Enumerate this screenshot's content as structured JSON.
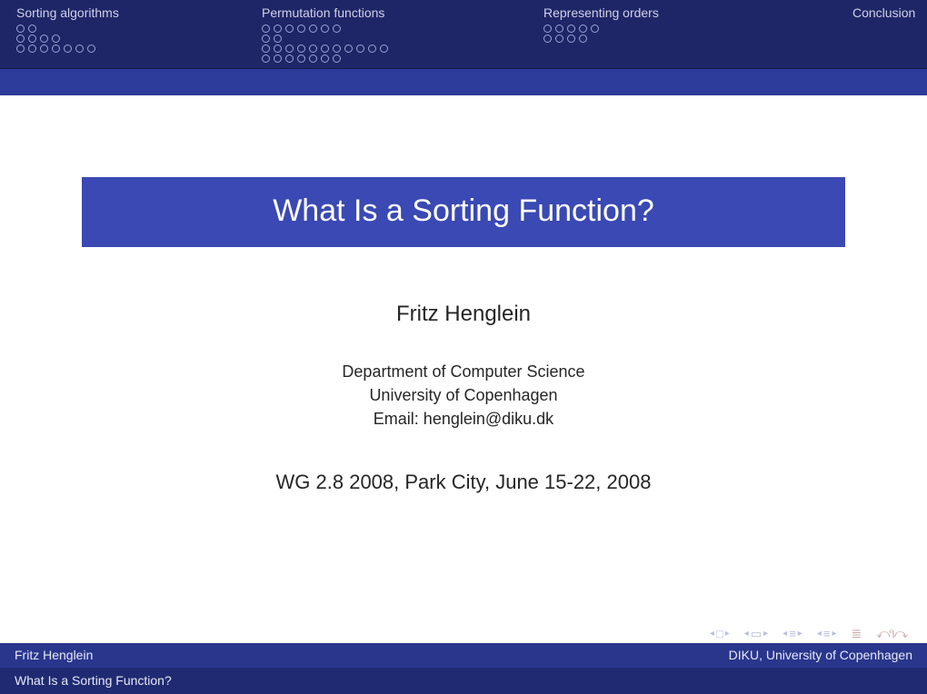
{
  "nav": {
    "sections": [
      {
        "label": "Sorting algorithms",
        "dot_rows": [
          2,
          4,
          7
        ]
      },
      {
        "label": "Permutation functions",
        "dot_rows": [
          7,
          2,
          11,
          7
        ]
      },
      {
        "label": "Representing orders",
        "dot_rows": [
          5,
          4
        ]
      },
      {
        "label": "Conclusion",
        "dot_rows": []
      }
    ]
  },
  "title": "What Is a Sorting Function?",
  "author": "Fritz Henglein",
  "affiliation": {
    "dept": "Department of Computer Science",
    "univ": "University of Copenhagen",
    "email": "Email: henglein@diku.dk"
  },
  "venue": "WG 2.8 2008, Park City, June 15-22, 2008",
  "footer": {
    "left": "Fritz Henglein",
    "right": "DIKU, University of Copenhagen",
    "bottom": "What Is a Sorting Function?"
  }
}
